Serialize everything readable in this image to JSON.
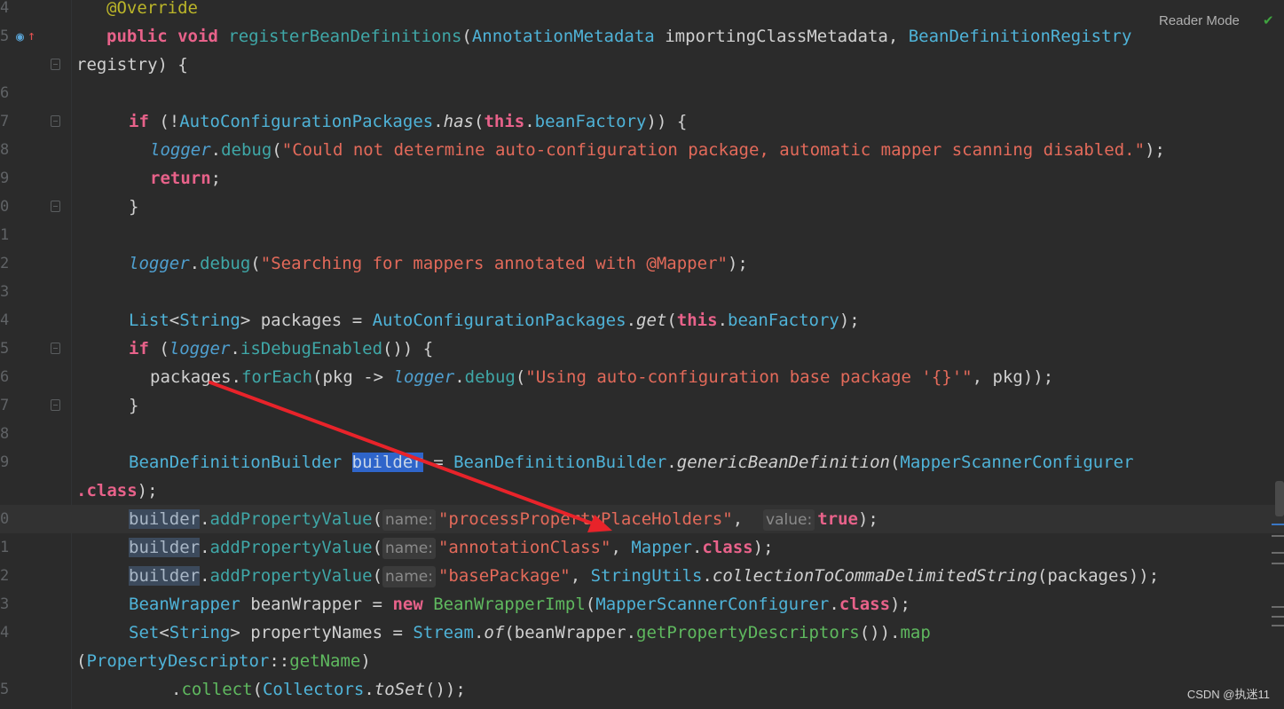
{
  "editor": {
    "reader_mode_label": "Reader Mode",
    "watermark": "CSDN @执迷11",
    "lines": {
      "l4": {
        "num": "4",
        "tokens": [
          [
            "ann",
            "@Override"
          ]
        ]
      },
      "l5": {
        "num": "5",
        "tokens": [
          [
            "kw2",
            "public "
          ],
          [
            "kw2",
            "void "
          ],
          [
            "m2",
            "registerBeanDefinitions"
          ],
          [
            "pl",
            "("
          ],
          [
            "cls",
            "AnnotationMetadata"
          ],
          [
            "pl",
            " importingClassMetadata, "
          ],
          [
            "cls",
            "BeanDefinitionRegistry"
          ]
        ]
      },
      "l5b": {
        "num": "",
        "tokens": [
          [
            "pl",
            "registry) {"
          ]
        ]
      },
      "l6": {
        "num": "6",
        "tokens": []
      },
      "l7": {
        "num": "7",
        "tokens": [
          [
            "kw2",
            "if "
          ],
          [
            "pl",
            "(!"
          ],
          [
            "cls",
            "AutoConfigurationPackages"
          ],
          [
            "pl",
            "."
          ],
          [
            "it pl",
            "has"
          ],
          [
            "pl",
            "("
          ],
          [
            "kw2",
            "this"
          ],
          [
            "pl",
            "."
          ],
          [
            "cls",
            "beanFactory"
          ],
          [
            "pl",
            ")) {"
          ]
        ]
      },
      "l8": {
        "num": "8",
        "tokens": [
          [
            "lg",
            "logger"
          ],
          [
            "pl",
            "."
          ],
          [
            "m2",
            "debug"
          ],
          [
            "pl",
            "("
          ],
          [
            "st",
            "\"Could not determine auto-configuration package, automatic mapper scanning disabled.\""
          ],
          [
            "pl",
            ");"
          ]
        ]
      },
      "l9": {
        "num": "9",
        "tokens": [
          [
            "kw2",
            "return"
          ],
          [
            "pl",
            ";"
          ]
        ]
      },
      "l10": {
        "num": "0",
        "tokens": [
          [
            "pl",
            "}"
          ]
        ]
      },
      "l11": {
        "num": "1",
        "tokens": []
      },
      "l12": {
        "num": "2",
        "tokens": [
          [
            "lg",
            "logger"
          ],
          [
            "pl",
            "."
          ],
          [
            "m2",
            "debug"
          ],
          [
            "pl",
            "("
          ],
          [
            "st",
            "\"Searching for mappers annotated with @Mapper\""
          ],
          [
            "pl",
            ");"
          ]
        ]
      },
      "l13": {
        "num": "3",
        "tokens": []
      },
      "l14": {
        "num": "4",
        "tokens": [
          [
            "cls",
            "List"
          ],
          [
            "pl",
            "<"
          ],
          [
            "cls",
            "String"
          ],
          [
            "pl",
            "> packages = "
          ],
          [
            "cls",
            "AutoConfigurationPackages"
          ],
          [
            "pl",
            "."
          ],
          [
            "it pl",
            "get"
          ],
          [
            "pl",
            "("
          ],
          [
            "kw2",
            "this"
          ],
          [
            "pl",
            "."
          ],
          [
            "cls",
            "beanFactory"
          ],
          [
            "pl",
            ");"
          ]
        ]
      },
      "l15": {
        "num": "5",
        "tokens": [
          [
            "kw2",
            "if "
          ],
          [
            "pl",
            "("
          ],
          [
            "lg",
            "logger"
          ],
          [
            "pl",
            "."
          ],
          [
            "m2",
            "isDebugEnabled"
          ],
          [
            "pl",
            "()) {"
          ]
        ]
      },
      "l16": {
        "num": "6",
        "tokens": [
          [
            "pl",
            "packages."
          ],
          [
            "m2",
            "forEach"
          ],
          [
            "pl",
            "(pkg -> "
          ],
          [
            "lg",
            "logger"
          ],
          [
            "pl",
            "."
          ],
          [
            "m2",
            "debug"
          ],
          [
            "pl",
            "("
          ],
          [
            "st",
            "\"Using auto-configuration base package '{}'\""
          ],
          [
            "pl",
            ", pkg));"
          ]
        ]
      },
      "l17": {
        "num": "7",
        "tokens": [
          [
            "pl",
            "}"
          ]
        ]
      },
      "l18": {
        "num": "8",
        "tokens": []
      },
      "l19": {
        "num": "9",
        "tokens": [
          [
            "cls",
            "BeanDefinitionBuilder "
          ],
          [
            "sel",
            "builder"
          ],
          [
            "pl",
            " = "
          ],
          [
            "cls",
            "BeanDefinitionBuilder"
          ],
          [
            "pl",
            "."
          ],
          [
            "it pl",
            "genericBeanDefinition"
          ],
          [
            "pl",
            "("
          ],
          [
            "cls",
            "MapperScannerConfigurer"
          ]
        ]
      },
      "l19b": {
        "num": "",
        "tokens": [
          [
            "kw2",
            ".class"
          ],
          [
            "pl",
            ");"
          ]
        ]
      },
      "l20": {
        "num": "0",
        "tokens": [
          [
            "occ",
            "builder"
          ],
          [
            "pl",
            "."
          ],
          [
            "m2",
            "addPropertyValue"
          ],
          [
            "pl",
            "("
          ],
          [
            "hint",
            "name:"
          ],
          [
            "st",
            "\"processPropertyPlaceHolders\""
          ],
          [
            "pl",
            ",  "
          ],
          [
            "hint",
            "value:"
          ],
          [
            "kw2",
            "true"
          ],
          [
            "pl",
            ");"
          ]
        ]
      },
      "l21": {
        "num": "1",
        "tokens": [
          [
            "occ",
            "builder"
          ],
          [
            "pl",
            "."
          ],
          [
            "m2",
            "addPropertyValue"
          ],
          [
            "pl",
            "("
          ],
          [
            "hint",
            "name:"
          ],
          [
            "st",
            "\"annotationClass\""
          ],
          [
            "pl",
            ", "
          ],
          [
            "cls",
            "Mapper"
          ],
          [
            "pl",
            "."
          ],
          [
            "kw2",
            "class"
          ],
          [
            "pl",
            ");"
          ]
        ]
      },
      "l22": {
        "num": "2",
        "tokens": [
          [
            "occ",
            "builder"
          ],
          [
            "pl",
            "."
          ],
          [
            "m2",
            "addPropertyValue"
          ],
          [
            "pl",
            "("
          ],
          [
            "hint",
            "name:"
          ],
          [
            "st",
            "\"basePackage\""
          ],
          [
            "pl",
            ", "
          ],
          [
            "cls",
            "StringUtils"
          ],
          [
            "pl",
            "."
          ],
          [
            "it pl",
            "collectionToCommaDelimitedString"
          ],
          [
            "pl",
            "(packages));"
          ]
        ]
      },
      "l23": {
        "num": "3",
        "tokens": [
          [
            "cls",
            "BeanWrapper"
          ],
          [
            "pl",
            " beanWrapper = "
          ],
          [
            "kw2",
            "new "
          ],
          [
            "m",
            "BeanWrapperImpl"
          ],
          [
            "pl",
            "("
          ],
          [
            "cls",
            "MapperScannerConfigurer"
          ],
          [
            "pl",
            "."
          ],
          [
            "kw2",
            "class"
          ],
          [
            "pl",
            ");"
          ]
        ]
      },
      "l24": {
        "num": "4",
        "tokens": [
          [
            "cls",
            "Set"
          ],
          [
            "pl",
            "<"
          ],
          [
            "cls",
            "String"
          ],
          [
            "pl",
            "> propertyNames = "
          ],
          [
            "cls",
            "Stream"
          ],
          [
            "pl",
            "."
          ],
          [
            "it pl",
            "of"
          ],
          [
            "pl",
            "(beanWrapper."
          ],
          [
            "m",
            "getPropertyDescriptors"
          ],
          [
            "pl",
            "())."
          ],
          [
            "m",
            "map"
          ]
        ]
      },
      "l24b": {
        "num": "",
        "tokens": [
          [
            "pl",
            "("
          ],
          [
            "cls",
            "PropertyDescriptor"
          ],
          [
            "pl",
            "::"
          ],
          [
            "m",
            "getName"
          ],
          [
            "pl",
            ")"
          ]
        ]
      },
      "l25": {
        "num": "5",
        "tokens": [
          [
            "pl",
            "."
          ],
          [
            "m",
            "collect"
          ],
          [
            "pl",
            "("
          ],
          [
            "cls",
            "Collectors"
          ],
          [
            "pl",
            "."
          ],
          [
            "it pl",
            "toSet"
          ],
          [
            "pl",
            "());"
          ]
        ]
      }
    }
  }
}
